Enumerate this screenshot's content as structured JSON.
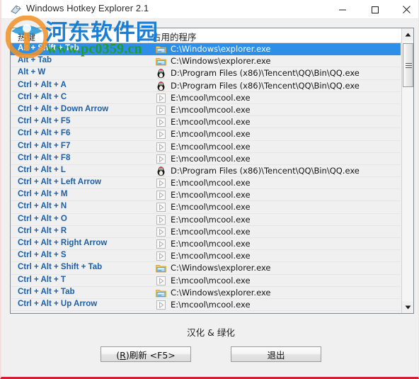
{
  "window": {
    "title": "Windows Hotkey Explorer 2.1",
    "icon": "hotkey-app-icon",
    "controls": {
      "minimize": "minimize-icon",
      "maximize": "maximize-icon",
      "close": "close-icon"
    }
  },
  "watermark": {
    "site_name": "河东软件园",
    "url": "www.pc0359.cn",
    "logo": "pc0359-logo"
  },
  "list": {
    "headers": {
      "hotkey": "热键",
      "program": "占用的程序"
    },
    "selected_index": 0,
    "rows": [
      {
        "hotkey": "Alt + Shift + Tab",
        "program": "C:\\Windows\\explorer.exe",
        "icon": "explorer-icon"
      },
      {
        "hotkey": "Alt + Tab",
        "program": "C:\\Windows\\explorer.exe",
        "icon": "explorer-icon"
      },
      {
        "hotkey": "Alt + W",
        "program": "D:\\Program Files (x86)\\Tencent\\QQ\\Bin\\QQ.exe",
        "icon": "qq-penguin-icon"
      },
      {
        "hotkey": "Ctrl + Alt + A",
        "program": "D:\\Program Files (x86)\\Tencent\\QQ\\Bin\\QQ.exe",
        "icon": "qq-penguin-icon"
      },
      {
        "hotkey": "Ctrl + Alt + C",
        "program": "E:\\mcool\\mcool.exe",
        "icon": "mcool-play-icon"
      },
      {
        "hotkey": "Ctrl + Alt + Down Arrow",
        "program": "E:\\mcool\\mcool.exe",
        "icon": "mcool-play-icon"
      },
      {
        "hotkey": "Ctrl + Alt + F5",
        "program": "E:\\mcool\\mcool.exe",
        "icon": "mcool-play-icon"
      },
      {
        "hotkey": "Ctrl + Alt + F6",
        "program": "E:\\mcool\\mcool.exe",
        "icon": "mcool-play-icon"
      },
      {
        "hotkey": "Ctrl + Alt + F7",
        "program": "E:\\mcool\\mcool.exe",
        "icon": "mcool-play-icon"
      },
      {
        "hotkey": "Ctrl + Alt + F8",
        "program": "E:\\mcool\\mcool.exe",
        "icon": "mcool-play-icon"
      },
      {
        "hotkey": "Ctrl + Alt + L",
        "program": "D:\\Program Files (x86)\\Tencent\\QQ\\Bin\\QQ.exe",
        "icon": "qq-penguin-icon"
      },
      {
        "hotkey": "Ctrl + Alt + Left Arrow",
        "program": "E:\\mcool\\mcool.exe",
        "icon": "mcool-play-icon"
      },
      {
        "hotkey": "Ctrl + Alt + M",
        "program": "E:\\mcool\\mcool.exe",
        "icon": "mcool-play-icon"
      },
      {
        "hotkey": "Ctrl + Alt + N",
        "program": "E:\\mcool\\mcool.exe",
        "icon": "mcool-play-icon"
      },
      {
        "hotkey": "Ctrl + Alt + O",
        "program": "E:\\mcool\\mcool.exe",
        "icon": "mcool-play-icon"
      },
      {
        "hotkey": "Ctrl + Alt + R",
        "program": "E:\\mcool\\mcool.exe",
        "icon": "mcool-play-icon"
      },
      {
        "hotkey": "Ctrl + Alt + Right Arrow",
        "program": "E:\\mcool\\mcool.exe",
        "icon": "mcool-play-icon"
      },
      {
        "hotkey": "Ctrl + Alt + S",
        "program": "E:\\mcool\\mcool.exe",
        "icon": "mcool-play-icon"
      },
      {
        "hotkey": "Ctrl + Alt + Shift + Tab",
        "program": "C:\\Windows\\explorer.exe",
        "icon": "explorer-icon"
      },
      {
        "hotkey": "Ctrl + Alt + T",
        "program": "E:\\mcool\\mcool.exe",
        "icon": "mcool-play-icon"
      },
      {
        "hotkey": "Ctrl + Alt + Tab",
        "program": "C:\\Windows\\explorer.exe",
        "icon": "explorer-icon"
      },
      {
        "hotkey": "Ctrl + Alt + Up Arrow",
        "program": "E:\\mcool\\mcool.exe",
        "icon": "mcool-play-icon"
      }
    ]
  },
  "footer": {
    "note": "汉化 & 绿化",
    "refresh_prefix": "(",
    "refresh_accel": "R",
    "refresh_suffix": ")刷新 <F5>",
    "exit_label": "退出"
  },
  "colors": {
    "selection": "#2e8fe8",
    "hotkey_text": "#1a5fa8",
    "accent_bottom": "#d6202f",
    "watermark_blue": "#1a7fd4",
    "watermark_green": "#1f9e2a"
  }
}
